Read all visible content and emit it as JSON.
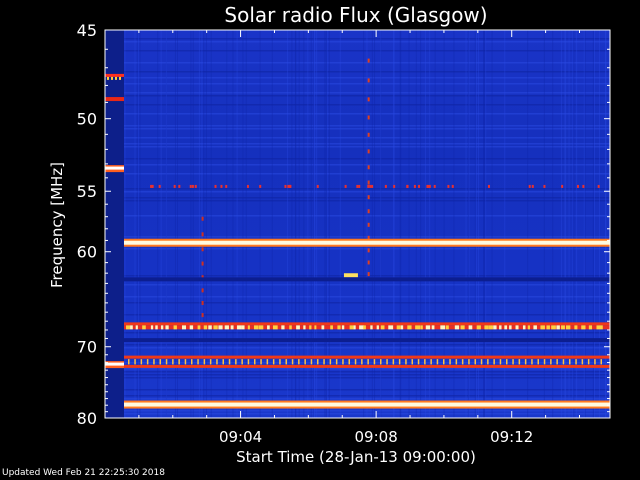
{
  "chart_data": {
    "type": "heatmap",
    "title": "Solar radio Flux (Glasgow)",
    "xlabel": "Start Time (28-Jan-13 09:00:00)",
    "ylabel": "Frequency [MHz]",
    "x_ticks": [
      "09:04",
      "09:08",
      "09:12"
    ],
    "x_tick_minutes": [
      4,
      8,
      12
    ],
    "xlim_minutes": [
      0,
      14.9
    ],
    "y_ticks": [
      45,
      50,
      55,
      60,
      70,
      80
    ],
    "ylim": [
      45,
      80
    ],
    "y_scale": "reciprocal",
    "colormap": "blue-red-yellow-white",
    "background_color": "#1530c0",
    "emission_lines": [
      {
        "freq": 47.4,
        "kind": "dashed-red"
      },
      {
        "freq": 48.8,
        "kind": "red-lead"
      },
      {
        "freq": 53.3,
        "kind": "white-lead"
      },
      {
        "freq": 59.2,
        "kind": "bright-white"
      },
      {
        "freq": 62.6,
        "kind": "dark-blue"
      },
      {
        "freq": 67.3,
        "kind": "red"
      },
      {
        "freq": 67.7,
        "kind": "speckled-white"
      },
      {
        "freq": 69.2,
        "kind": "dark-blue"
      },
      {
        "freq": 71.3,
        "kind": "red"
      },
      {
        "freq": 72.5,
        "kind": "red"
      },
      {
        "freq": 72.2,
        "kind": "white-lead"
      },
      {
        "freq": 77.9,
        "kind": "bright-white"
      }
    ]
  },
  "footer": {
    "updated": "Updated Wed Feb 21 22:25:30 2018"
  }
}
